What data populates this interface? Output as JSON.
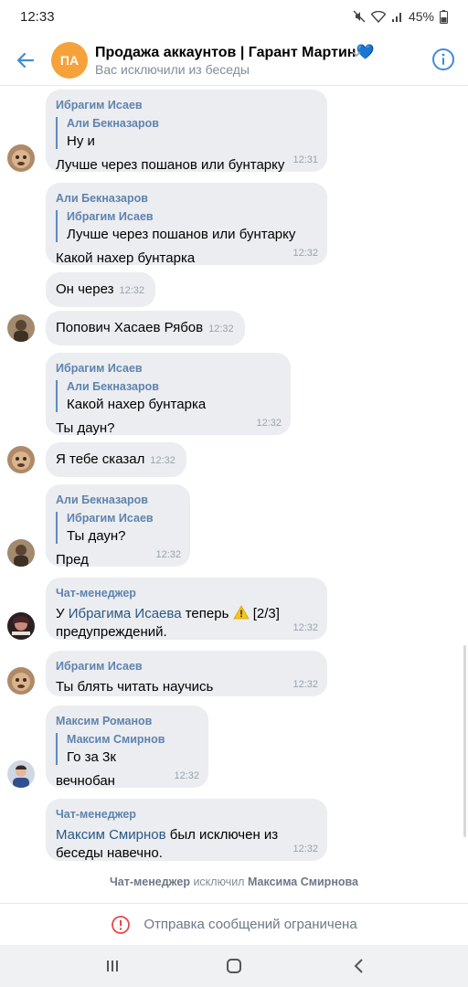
{
  "status": {
    "time": "12:33",
    "battery": "45%"
  },
  "header": {
    "avatar_initials": "ПА",
    "title": "Продажа аккаунтов | Гарант Мартин",
    "title_emoji": "💙",
    "subtitle": "Вас исключили из беседы",
    "colors": {
      "avatar": "#f6a23a",
      "accent": "#3f8ae0"
    }
  },
  "messages": [
    {
      "author": "Ибрагим Исаев",
      "quote_author": "Али Бекназаров",
      "quote_text": "Ну и",
      "text": "Лучше через пошанов или бунтарку",
      "time": "12:31"
    },
    {
      "author": "Али Бекназаров",
      "quote_author": "Ибрагим Исаев",
      "quote_text": "Лучше через пошанов или бунтарку",
      "text": "Какой нахер бунтарка",
      "time": "12:32"
    },
    {
      "text": "Он через",
      "time": "12:32"
    },
    {
      "text": "Попович Хасаев Рябов",
      "time": "12:32"
    },
    {
      "author": "Ибрагим Исаев",
      "quote_author": "Али Бекназаров",
      "quote_text": "Какой нахер бунтарка",
      "text": "Ты даун?",
      "time": "12:32"
    },
    {
      "text": "Я тебе сказал",
      "time": "12:32"
    },
    {
      "author": "Али Бекназаров",
      "quote_author": "Ибрагим Исаев",
      "quote_text": "Ты даун?",
      "text": "Пред",
      "time": "12:32"
    },
    {
      "author": "Чат-менеджер",
      "text_before": "У ",
      "link": "Ибрагима Исаева",
      "text_after": " теперь",
      "warning_counter": "[2/3]",
      "text_line2": "предупреждений.",
      "time": "12:32"
    },
    {
      "author": "Ибрагим Исаев",
      "text": "Ты блять читать научись",
      "time": "12:32"
    },
    {
      "author": "Максим Романов",
      "quote_author": "Максим Смирнов",
      "quote_text": "Го за 3к",
      "text": "вечнобан",
      "time": "12:32"
    },
    {
      "author": "Чат-менеджер",
      "link": "Максим Смирнов",
      "text_after": " был исключен из",
      "text_line2": "беседы навечно.",
      "time": "12:32"
    }
  ],
  "service": {
    "actor": "Чат-менеджер",
    "action": "исключил",
    "target": "Максима Смирнова"
  },
  "restricted": {
    "text": "Отправка сообщений ограничена"
  },
  "icons": [
    "back-arrow-icon",
    "chevron-down-icon",
    "info-icon",
    "warning-icon",
    "restricted-icon",
    "recents-icon",
    "home-icon",
    "nav-back-icon"
  ]
}
